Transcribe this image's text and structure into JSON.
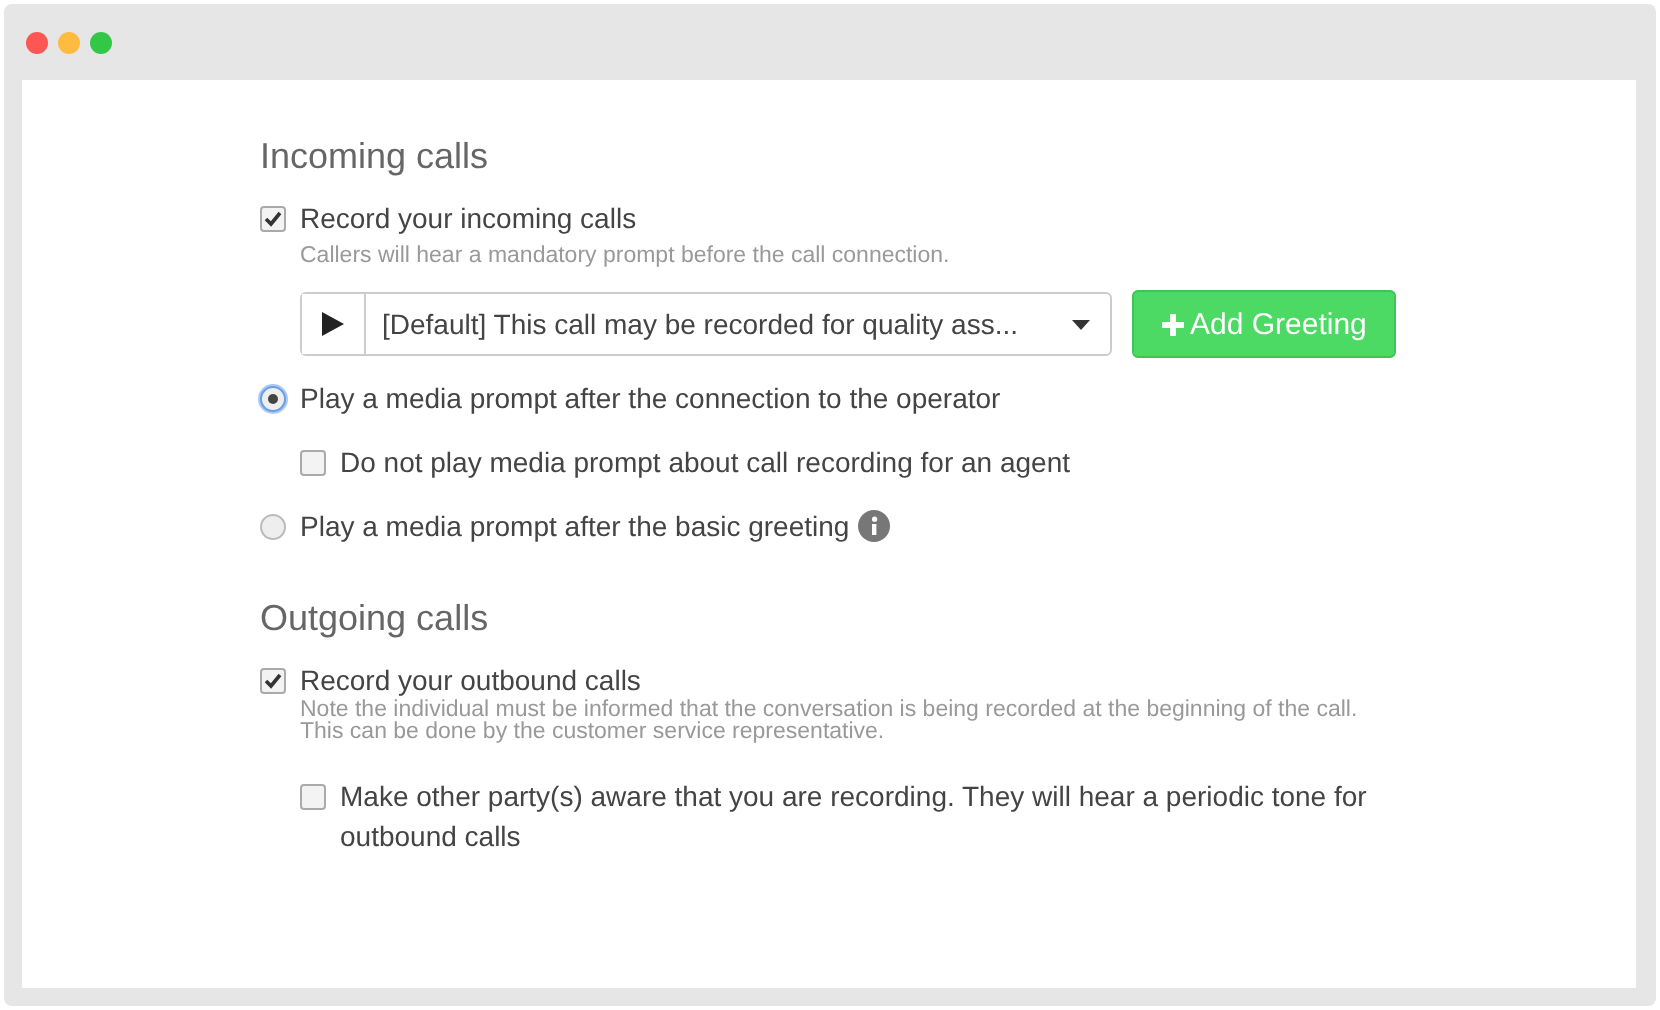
{
  "incoming": {
    "title": "Incoming calls",
    "record": {
      "label": "Record your incoming calls",
      "checked": true
    },
    "note": "Callers will hear a mandatory prompt before the call connection.",
    "greeting_select": {
      "value": "[Default] This call may be recorded for quality ass..."
    },
    "add_button": "Add Greeting",
    "options": [
      {
        "kind": "radio",
        "label": "Play a media prompt after the connection to the operator",
        "selected": true,
        "info": false,
        "children": [
          {
            "kind": "checkbox",
            "label": "Do not play media prompt about call recording for an agent",
            "checked": false
          }
        ]
      },
      {
        "kind": "radio",
        "label": "Play a media prompt after the basic greeting",
        "selected": false,
        "info": true
      }
    ]
  },
  "outgoing": {
    "title": "Outgoing calls",
    "record": {
      "label": "Record your outbound calls",
      "checked": true
    },
    "note": "Note the individual must be informed that the conversation is being recorded at the beginning of the call. This can be done by the customer service representative.",
    "options": [
      {
        "kind": "checkbox",
        "label": "Make other party(s) aware that you are recording. They will hear a periodic tone for outbound calls",
        "checked": false
      }
    ]
  }
}
